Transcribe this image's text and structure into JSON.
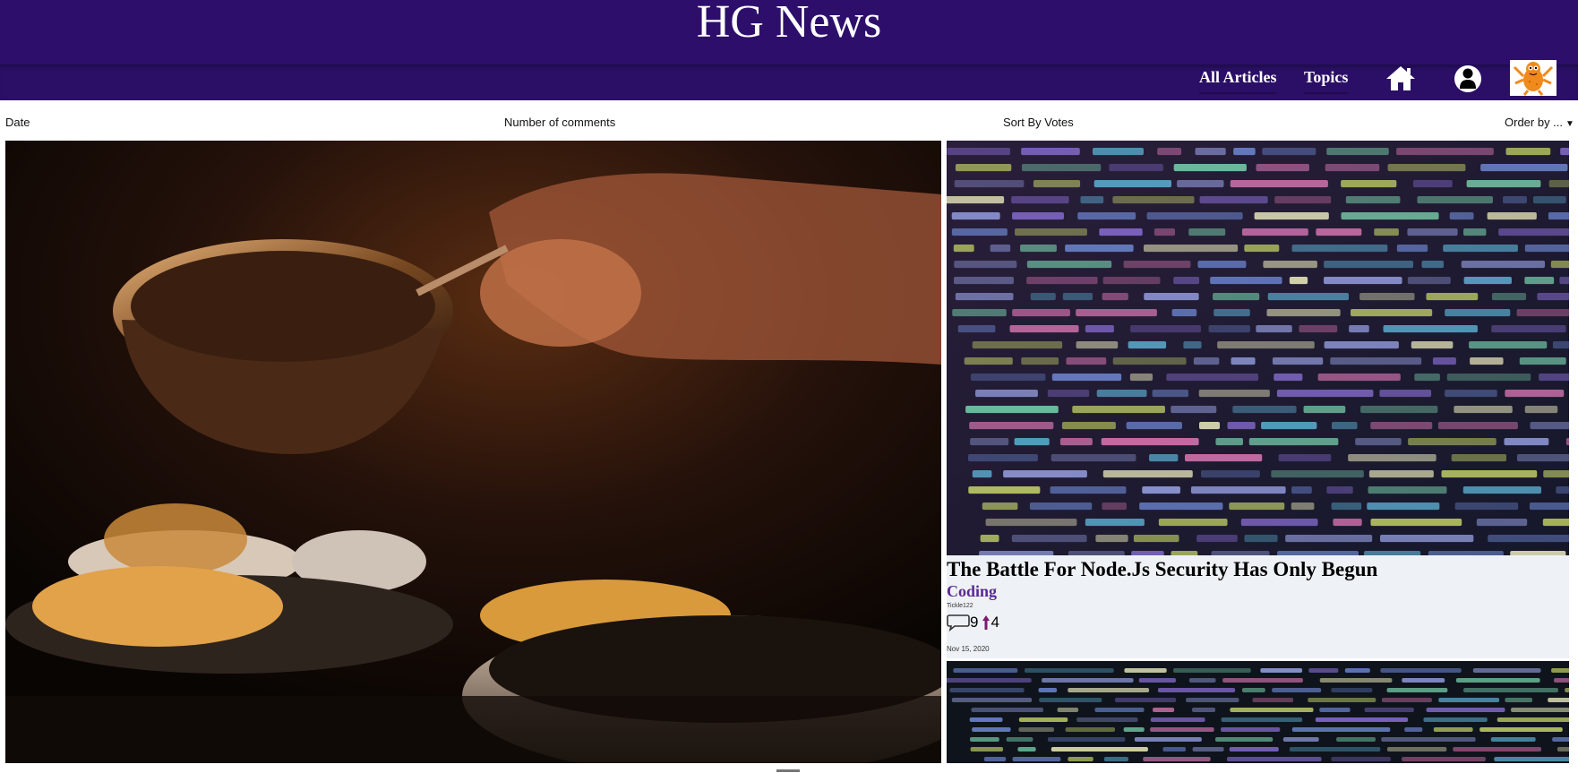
{
  "header": {
    "title": "HG News"
  },
  "nav": {
    "all_articles": "All Articles",
    "topics": "Topics",
    "home_icon": "home-icon",
    "user_icon": "user-icon",
    "avatar": "orange-monster-avatar"
  },
  "sort": {
    "date": "Date",
    "comments": "Number of comments",
    "votes": "Sort By Votes",
    "order": "Order by ..."
  },
  "articles": [
    {
      "title": "The Battle For Node.Js Security Has Only Begun",
      "topic": "Coding",
      "author": "Tickle122",
      "comments": "9",
      "votes": "4",
      "date": "Nov 15, 2020"
    }
  ],
  "colors": {
    "header_bg": "#2d0f6b",
    "topic": "#5b2a92",
    "card_bg": "#eef2f6",
    "vote_arrow": "#7a1a6f"
  }
}
